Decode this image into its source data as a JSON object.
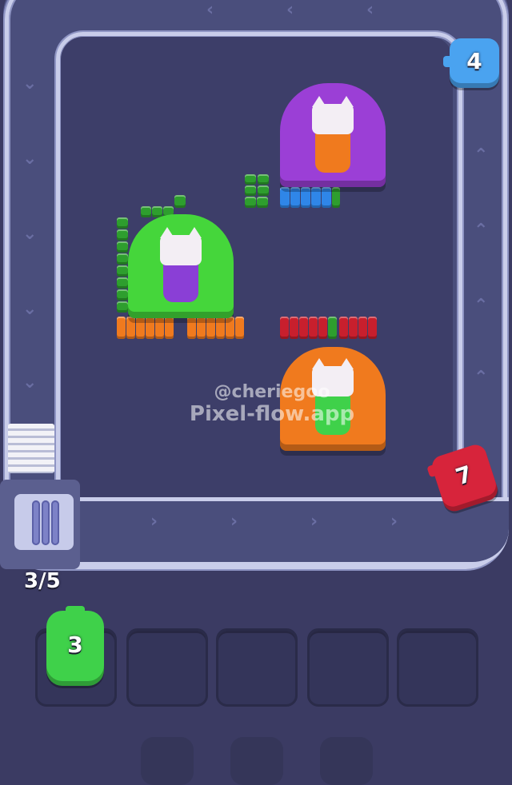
{
  "hud": {
    "queue_counter": "3/5"
  },
  "watermark": {
    "handle": "@cheriegoo",
    "site": "Pixel-flow.app"
  },
  "conveyor_pigs": [
    {
      "name": "blue-pig",
      "count": "4",
      "color": "#4aa3f0"
    },
    {
      "name": "red-pig",
      "count": "7",
      "color": "#d7243b"
    }
  ],
  "tray": {
    "slots": 5,
    "occupied": [
      {
        "slot": 1,
        "name": "green-pig",
        "count": "3",
        "color": "#3fd14a"
      }
    ]
  },
  "colors": {
    "background": "#3b3b63",
    "purple_cave": "#9b3fd6",
    "green_cave": "#45d63b",
    "orange_cave": "#f07a1e",
    "block_green": "#2e9e2e",
    "block_blue": "#2f86e8",
    "block_orange": "#f07a1e",
    "block_red": "#c81f2d"
  },
  "icons": [
    "chevron-left-icon",
    "chevron-down-icon",
    "chevron-up-icon",
    "chevron-right-icon"
  ]
}
